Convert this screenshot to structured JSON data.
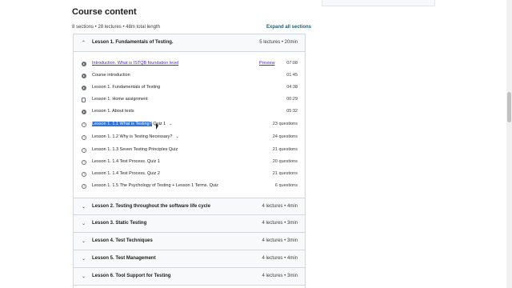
{
  "course_content": {
    "title": "Course content",
    "summary": "8 sections • 28 lectures • 48m total length",
    "expand_all": "Expand all sections"
  },
  "open_section": {
    "title": "Lesson 1. Fundamentals of Testing.",
    "meta": "5 lectures • 20min",
    "expanded": true
  },
  "lectures": [
    {
      "title": "Introduction. What is ISTQB foundation level",
      "meta": "07:08",
      "icon": "play-circle-icon",
      "link": true,
      "preview": "Preview"
    },
    {
      "title": "Course introduction",
      "meta": "01:45",
      "icon": "play-circle-icon"
    },
    {
      "title": "Lesson 1. Fundamentals of Testing",
      "meta": "04:38",
      "icon": "play-circle-icon"
    },
    {
      "title": "Lesson 1. Home assignment",
      "meta": "00:29",
      "icon": "document-icon"
    },
    {
      "title": "Lesson 1. About tests",
      "meta": "05:32",
      "icon": "play-circle-icon"
    },
    {
      "title_highlighted": "Lesson 1. 1.1 What is Testing?",
      "title_rest": " Quiz 1",
      "meta": "23 questions",
      "icon": "quiz-icon",
      "has_dropdown": true
    },
    {
      "title": "Lesson 1. 1.2 Why is Testing Necessary?",
      "meta": "24 questions",
      "icon": "quiz-icon",
      "has_dropdown": true
    },
    {
      "title": "Lesson 1. 1.3 Seven Testing Principles Quiz",
      "meta": "21 questions",
      "icon": "quiz-icon"
    },
    {
      "title": "Lesson 1. 1.4 Test Process. Quiz 1",
      "meta": "20 questions",
      "icon": "quiz-icon"
    },
    {
      "title": "Lesson 1. 1.4 Test Process. Quiz 2",
      "meta": "21 questions",
      "icon": "quiz-icon"
    },
    {
      "title": "Lesson 1. 1.5 The Psychology of Testing + Lesson 1 Terms. Quiz",
      "meta": "6 questions",
      "icon": "quiz-icon"
    }
  ],
  "sections": [
    {
      "title": "Lesson 2. Testing throughout the software life cycle",
      "meta": "4 lectures • 4min"
    },
    {
      "title": "Lesson 3. Static Testing",
      "meta": "4 lectures • 3min"
    },
    {
      "title": "Lesson 4. Test Techniques",
      "meta": "4 lectures • 3min"
    },
    {
      "title": "Lesson 5. Test Management",
      "meta": "4 lectures • 4min"
    },
    {
      "title": "Lesson 6. Tool Support for Testing",
      "meta": "4 lectures • 3min"
    }
  ],
  "icons": {
    "chevron_up": "⌃",
    "chevron_down": "⌄"
  }
}
